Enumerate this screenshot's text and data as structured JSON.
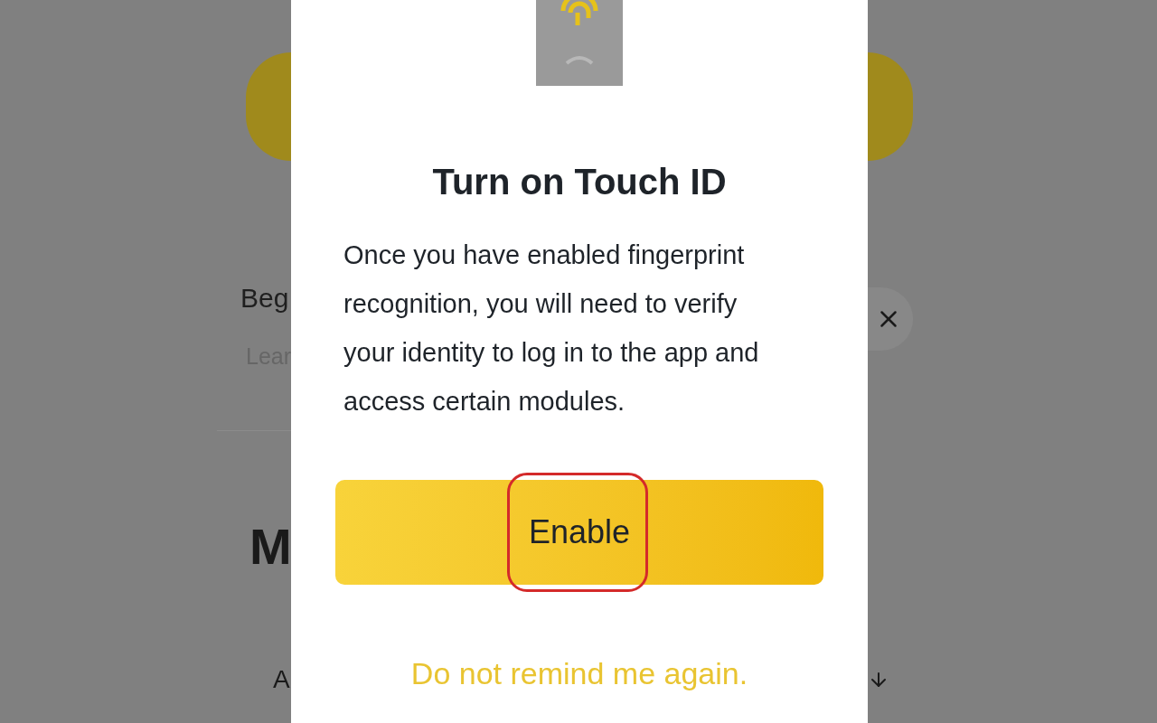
{
  "background": {
    "banner_text": "Beg",
    "banner_subtext": "Lear",
    "section_heading": "M",
    "list_item": "A"
  },
  "dialog": {
    "title": "Turn on Touch ID",
    "message": "Once you have enabled fingerprint recognition, you will need to verify your identity to log in to the app and access certain modules.",
    "primary_button": "Enable",
    "primary_highlighted": true,
    "secondary_link": "Do not remind me again."
  }
}
